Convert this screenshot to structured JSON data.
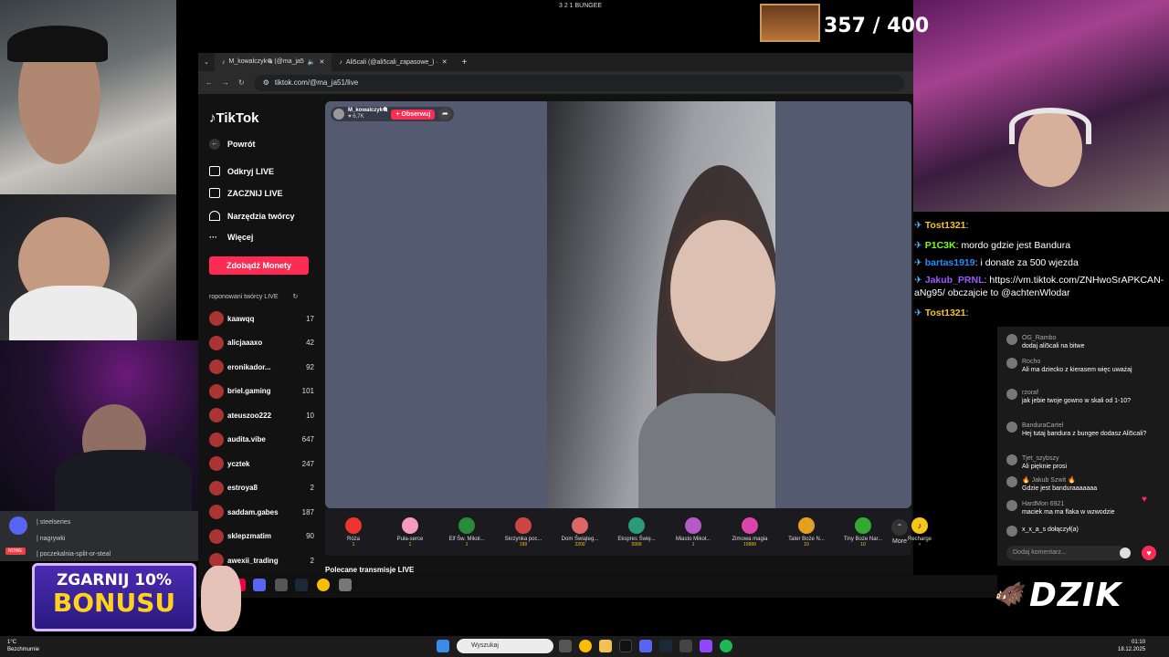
{
  "overlay": {
    "top_center": "3 2 1 BUNGEE",
    "counter": "357 / 400",
    "bonus_line1": "ZGARNIJ 10%",
    "bonus_line2": "BONUSU",
    "sponsor": "DZIK"
  },
  "browser": {
    "tabs": [
      {
        "label": "M_kowalczyk🎕 (@ma_ja5"
      },
      {
        "label": "Ali5cali (@ali5cali_zapasowe_) ·"
      }
    ],
    "url": "tiktok.com/@ma_ja51/live"
  },
  "tiktok": {
    "logo": "TikTok",
    "nav": [
      "Powrót",
      "Odkryj LIVE",
      "ZACZNIJ LIVE",
      "Narzędzia twórcy",
      "Więcej"
    ],
    "coins_button": "Zdobądź Monety",
    "suggested_title": "roponowani twórcy LIVE",
    "creators": [
      {
        "name": "kaawqq",
        "sub": "kaawqq 😃",
        "count": "17"
      },
      {
        "name": "alicjaaaxo",
        "sub": "",
        "count": "42"
      },
      {
        "name": "eronikador...",
        "sub": "rka 🧸",
        "count": "92"
      },
      {
        "name": "briel.gaming",
        "sub": "briel Gaming",
        "count": "101"
      },
      {
        "name": "ateuszoo222",
        "sub": "ateuszoo22 🐉",
        "count": "10"
      },
      {
        "name": "audita.vibe",
        "sub": "UDITA 🎀",
        "count": "647"
      },
      {
        "name": "ycztek",
        "sub": "ycztek 💎",
        "count": "247"
      },
      {
        "name": "estroya8",
        "sub": "Destroya 🌸 😉",
        "count": "2"
      },
      {
        "name": "saddam.gabes",
        "sub": "Saddam Kayak 🤣",
        "count": "187"
      },
      {
        "name": "sklepzmatim",
        "sub": "sklepzmatim",
        "count": "90"
      },
      {
        "name": "awexii_trading",
        "sub": "Awexii 🌢",
        "count": "2"
      }
    ],
    "host": {
      "name": "M_kowalczyk🎕",
      "likes": "♥ 6,7K",
      "follow": "+ Obserwuj"
    },
    "gifts": [
      {
        "name": "Róża",
        "price": "1"
      },
      {
        "name": "Puła-serce",
        "price": "1"
      },
      {
        "name": "Elf Św. Mikoł...",
        "price": "1"
      },
      {
        "name": "Skrzynka poc...",
        "price": "199"
      },
      {
        "name": "Dom Świąteg...",
        "price": "2200"
      },
      {
        "name": "Ekspres Świę...",
        "price": "5999"
      },
      {
        "name": "Miasto Mikoł...",
        "price": "1"
      },
      {
        "name": "Zimowa magia",
        "price": "19999"
      },
      {
        "name": "Tater Boże N...",
        "price": "10"
      },
      {
        "name": "Tiny Boże Nar...",
        "price": "10"
      }
    ],
    "more": "More",
    "recharge": "Recharge ›",
    "recommended": "Polecane transmisje LIVE",
    "comments": [
      {
        "user": "OG_Rambo",
        "text": "dodaj ali5cali na bitwe"
      },
      {
        "user": "Rocho",
        "text": "Ali ma dziecko z kierasem więc uważaj"
      },
      {
        "user": "rzoraf",
        "text": "jak jebie twoje gowno w skali od 1-10?"
      },
      {
        "user": "BanduraCartel",
        "text": "Hej tutaj bandura z bungee dodasz Ali5cali?"
      },
      {
        "user": "Tjet_szybszy",
        "text": "Ali pięknie prosi"
      },
      {
        "user": "🔥 Jakub Szwit 🔥",
        "text": "Gdzie jest banduraaaaaaa"
      },
      {
        "user": "HardMon 6921",
        "text": "maciek ma ma flaka w wzwodzie"
      },
      {
        "user": "",
        "text": "x_x_a_s  dołączył(a)"
      }
    ],
    "comment_placeholder": "Dodaj komentarz..."
  },
  "twitch_chat": [
    {
      "user": "Tost1321",
      "text": "",
      "color": "#f5c518"
    },
    {
      "user": "P1C3K",
      "text": "mordo gdzie jest Bandura",
      "color": "#7fff00"
    },
    {
      "user": "bartas1919",
      "text": "i donate za 500 wjezda",
      "color": "#1e90ff"
    },
    {
      "user": "Jakub_PRNL",
      "text": "https://vm.tiktok.com/ZNHwoSrAPKCAN-aNg95/ obczajcie to @achtenWlodar",
      "color": "#9b59ff"
    },
    {
      "user": "Tost1321",
      "text": "",
      "color": "#f5c518"
    }
  ],
  "discord": {
    "items": [
      "| steelseries",
      "| nagrywki",
      "| poczekalnia-split-or-steal"
    ],
    "badge": "NOWE"
  },
  "taskbar": {
    "search": "Wyszukaj",
    "weather": "1°C",
    "weather_sub": "Bezchmurnie",
    "time": "01:10",
    "date": "18.12.2025"
  },
  "colors": {
    "tiktok_red": "#fe2c55",
    "coin_gold": "#f5c518"
  }
}
